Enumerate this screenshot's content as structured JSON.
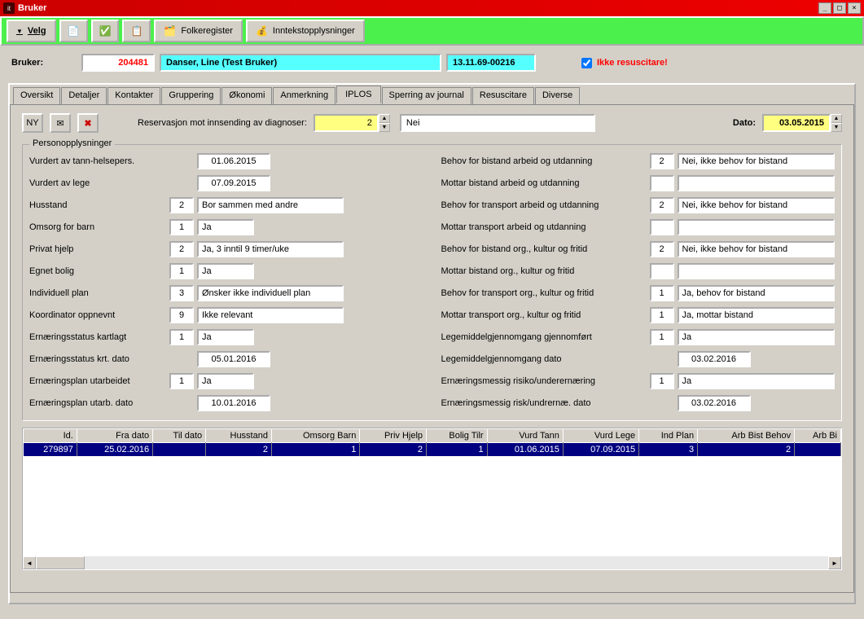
{
  "window": {
    "title": "Bruker"
  },
  "toolbar": {
    "velg": "Velg",
    "folkeregister": "Folkeregister",
    "inntekt": "Inntekstopplysninger"
  },
  "header": {
    "bruker_label": "Bruker:",
    "bruker_id": "204481",
    "bruker_name": "Danser, Line (Test Bruker)",
    "bruker_dob": "13.11.69-00216",
    "resus_label": "Ikke resuscitare!",
    "resus_checked": true
  },
  "tabs": [
    "Oversikt",
    "Detaljer",
    "Kontakter",
    "Gruppering",
    "Økonomi",
    "Anmerkning",
    "IPLOS",
    "Sperring av journal",
    "Resuscitare",
    "Diverse"
  ],
  "active_tab": "IPLOS",
  "iplos": {
    "reservasjon_label": "Reservasjon mot innsending av diagnoser:",
    "reservasjon_num": "2",
    "reservasjon_txt": "Nei",
    "dato_label": "Dato:",
    "dato_value": "03.05.2015",
    "fieldset_legend": "Personopplysninger",
    "left": [
      {
        "label": "Vurdert av tann-helsepers.",
        "num": "",
        "txt": "01.06.2015",
        "date": true
      },
      {
        "label": "Vurdert av lege",
        "num": "",
        "txt": "07.09.2015",
        "date": true
      },
      {
        "label": "Husstand",
        "num": "2",
        "txt": "Bor sammen med andre"
      },
      {
        "label": "Omsorg for barn",
        "num": "1",
        "txt": "Ja",
        "short": true
      },
      {
        "label": "Privat hjelp",
        "num": "2",
        "txt": "Ja, 3 inntil 9 timer/uke"
      },
      {
        "label": "Egnet bolig",
        "num": "1",
        "txt": "Ja",
        "short": true
      },
      {
        "label": "Individuell plan",
        "num": "3",
        "txt": "Ønsker ikke individuell plan"
      },
      {
        "label": "Koordinator oppnevnt",
        "num": "9",
        "txt": "Ikke relevant"
      },
      {
        "label": "Ernæringsstatus kartlagt",
        "num": "1",
        "txt": "Ja",
        "short": true
      },
      {
        "label": "Ernæringsstatus krt. dato",
        "num": "",
        "txt": "05.01.2016",
        "date": true
      },
      {
        "label": "Ernæringsplan utarbeidet",
        "num": "1",
        "txt": "Ja",
        "short": true
      },
      {
        "label": "Ernæringsplan utarb. dato",
        "num": "",
        "txt": "10.01.2016",
        "date": true
      }
    ],
    "right": [
      {
        "label": "Behov for bistand arbeid og utdanning",
        "num": "2",
        "txt": "Nei, ikke behov for bistand"
      },
      {
        "label": "Mottar bistand arbeid og utdanning",
        "num": "",
        "txt": ""
      },
      {
        "label": "Behov for transport arbeid og utdanning",
        "num": "2",
        "txt": "Nei, ikke behov for bistand"
      },
      {
        "label": "Mottar transport arbeid og utdanning",
        "num": "",
        "txt": ""
      },
      {
        "label": "Behov for bistand org., kultur og fritid",
        "num": "2",
        "txt": "Nei, ikke behov for bistand"
      },
      {
        "label": "Mottar bistand org., kultur og fritid",
        "num": "",
        "txt": ""
      },
      {
        "label": "Behov for transport org., kultur og fritid",
        "num": "1",
        "txt": "Ja, behov for bistand"
      },
      {
        "label": "Mottar transport org., kultur og fritid",
        "num": "1",
        "txt": "Ja, mottar bistand"
      },
      {
        "label": "Legemiddelgjennomgang gjennomført",
        "num": "1",
        "txt": "Ja"
      },
      {
        "label": "Legemiddelgjennomgang dato",
        "num": "",
        "txt": "03.02.2016",
        "date": true
      },
      {
        "label": "Ernæringsmessig risiko/underernæring",
        "num": "1",
        "txt": "Ja"
      },
      {
        "label": "Ernæringsmessig risk/undrernæ. dato",
        "num": "",
        "txt": "03.02.2016",
        "date": true
      }
    ],
    "grid": {
      "columns": [
        "Id.",
        "Fra dato",
        "Til dato",
        "Husstand",
        "Omsorg Barn",
        "Priv Hjelp",
        "Bolig Tilr",
        "Vurd Tann",
        "Vurd Lege",
        "Ind Plan",
        "Arb Bist Behov",
        "Arb Bi"
      ],
      "row": [
        "279897",
        "25.02.2016",
        "",
        "2",
        "1",
        "2",
        "1",
        "01.06.2015",
        "07.09.2015",
        "3",
        "2",
        ""
      ]
    }
  }
}
